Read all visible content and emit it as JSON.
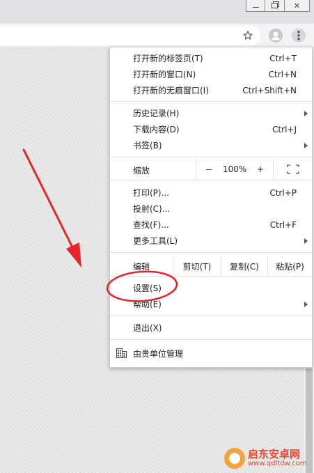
{
  "menu": {
    "group1": [
      {
        "label": "打开新的标签页(T)",
        "shortcut": "Ctrl+T"
      },
      {
        "label": "打开新的窗口(N)",
        "shortcut": "Ctrl+N"
      },
      {
        "label": "打开新的无痕窗口(I)",
        "shortcut": "Ctrl+Shift+N"
      }
    ],
    "group2": [
      {
        "label": "历史记录(H)"
      },
      {
        "label": "下载内容(D)",
        "shortcut": "Ctrl+J"
      },
      {
        "label": "书签(B)"
      }
    ],
    "zoom": {
      "label": "缩放",
      "minus": "－",
      "value": "100%",
      "plus": "+"
    },
    "group3": [
      {
        "label": "打印(P)...",
        "shortcut": "Ctrl+P"
      },
      {
        "label": "投射(C)..."
      },
      {
        "label": "查找(F)...",
        "shortcut": "Ctrl+F"
      },
      {
        "label": "更多工具(L)"
      }
    ],
    "edit": {
      "label": "编辑",
      "cut": "剪切(T)",
      "copy": "复制(C)",
      "paste": "粘贴(P)"
    },
    "group4": [
      {
        "label": "设置(S)"
      },
      {
        "label": "帮助(E)"
      }
    ],
    "exit": {
      "label": "退出(X)"
    },
    "managed": {
      "label": "由贵单位管理"
    }
  },
  "logo": {
    "name": "启东安卓网",
    "url": "www.qdltdw.com"
  },
  "colors": {
    "annotation_red": "#e5262a",
    "logo_orange": "#f3a33a"
  }
}
